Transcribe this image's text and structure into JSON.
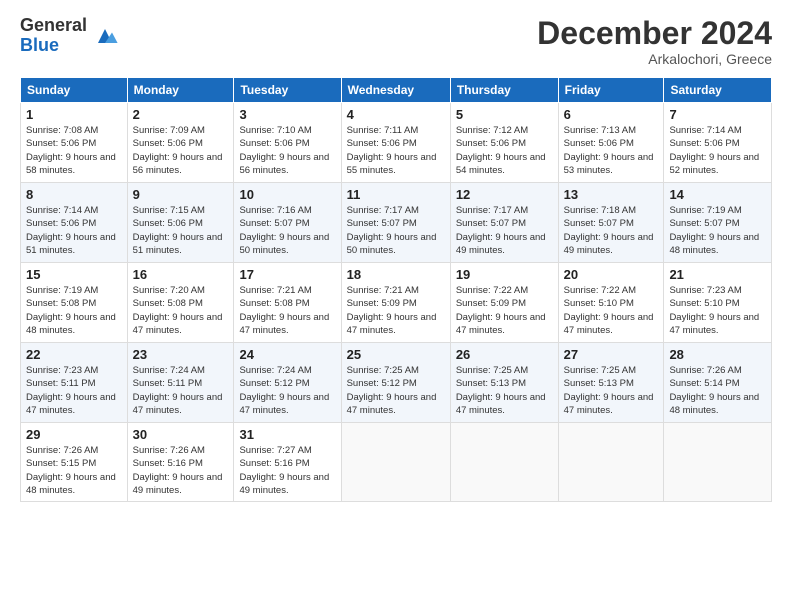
{
  "logo": {
    "general": "General",
    "blue": "Blue"
  },
  "header": {
    "month": "December 2024",
    "location": "Arkalochori, Greece"
  },
  "weekdays": [
    "Sunday",
    "Monday",
    "Tuesday",
    "Wednesday",
    "Thursday",
    "Friday",
    "Saturday"
  ],
  "weeks": [
    [
      {
        "day": "1",
        "sunrise": "7:08 AM",
        "sunset": "5:06 PM",
        "daylight": "9 hours and 58 minutes."
      },
      {
        "day": "2",
        "sunrise": "7:09 AM",
        "sunset": "5:06 PM",
        "daylight": "9 hours and 56 minutes."
      },
      {
        "day": "3",
        "sunrise": "7:10 AM",
        "sunset": "5:06 PM",
        "daylight": "9 hours and 56 minutes."
      },
      {
        "day": "4",
        "sunrise": "7:11 AM",
        "sunset": "5:06 PM",
        "daylight": "9 hours and 55 minutes."
      },
      {
        "day": "5",
        "sunrise": "7:12 AM",
        "sunset": "5:06 PM",
        "daylight": "9 hours and 54 minutes."
      },
      {
        "day": "6",
        "sunrise": "7:13 AM",
        "sunset": "5:06 PM",
        "daylight": "9 hours and 53 minutes."
      },
      {
        "day": "7",
        "sunrise": "7:14 AM",
        "sunset": "5:06 PM",
        "daylight": "9 hours and 52 minutes."
      }
    ],
    [
      {
        "day": "8",
        "sunrise": "7:14 AM",
        "sunset": "5:06 PM",
        "daylight": "9 hours and 51 minutes."
      },
      {
        "day": "9",
        "sunrise": "7:15 AM",
        "sunset": "5:06 PM",
        "daylight": "9 hours and 51 minutes."
      },
      {
        "day": "10",
        "sunrise": "7:16 AM",
        "sunset": "5:07 PM",
        "daylight": "9 hours and 50 minutes."
      },
      {
        "day": "11",
        "sunrise": "7:17 AM",
        "sunset": "5:07 PM",
        "daylight": "9 hours and 50 minutes."
      },
      {
        "day": "12",
        "sunrise": "7:17 AM",
        "sunset": "5:07 PM",
        "daylight": "9 hours and 49 minutes."
      },
      {
        "day": "13",
        "sunrise": "7:18 AM",
        "sunset": "5:07 PM",
        "daylight": "9 hours and 49 minutes."
      },
      {
        "day": "14",
        "sunrise": "7:19 AM",
        "sunset": "5:07 PM",
        "daylight": "9 hours and 48 minutes."
      }
    ],
    [
      {
        "day": "15",
        "sunrise": "7:19 AM",
        "sunset": "5:08 PM",
        "daylight": "9 hours and 48 minutes."
      },
      {
        "day": "16",
        "sunrise": "7:20 AM",
        "sunset": "5:08 PM",
        "daylight": "9 hours and 47 minutes."
      },
      {
        "day": "17",
        "sunrise": "7:21 AM",
        "sunset": "5:08 PM",
        "daylight": "9 hours and 47 minutes."
      },
      {
        "day": "18",
        "sunrise": "7:21 AM",
        "sunset": "5:09 PM",
        "daylight": "9 hours and 47 minutes."
      },
      {
        "day": "19",
        "sunrise": "7:22 AM",
        "sunset": "5:09 PM",
        "daylight": "9 hours and 47 minutes."
      },
      {
        "day": "20",
        "sunrise": "7:22 AM",
        "sunset": "5:10 PM",
        "daylight": "9 hours and 47 minutes."
      },
      {
        "day": "21",
        "sunrise": "7:23 AM",
        "sunset": "5:10 PM",
        "daylight": "9 hours and 47 minutes."
      }
    ],
    [
      {
        "day": "22",
        "sunrise": "7:23 AM",
        "sunset": "5:11 PM",
        "daylight": "9 hours and 47 minutes."
      },
      {
        "day": "23",
        "sunrise": "7:24 AM",
        "sunset": "5:11 PM",
        "daylight": "9 hours and 47 minutes."
      },
      {
        "day": "24",
        "sunrise": "7:24 AM",
        "sunset": "5:12 PM",
        "daylight": "9 hours and 47 minutes."
      },
      {
        "day": "25",
        "sunrise": "7:25 AM",
        "sunset": "5:12 PM",
        "daylight": "9 hours and 47 minutes."
      },
      {
        "day": "26",
        "sunrise": "7:25 AM",
        "sunset": "5:13 PM",
        "daylight": "9 hours and 47 minutes."
      },
      {
        "day": "27",
        "sunrise": "7:25 AM",
        "sunset": "5:13 PM",
        "daylight": "9 hours and 47 minutes."
      },
      {
        "day": "28",
        "sunrise": "7:26 AM",
        "sunset": "5:14 PM",
        "daylight": "9 hours and 48 minutes."
      }
    ],
    [
      {
        "day": "29",
        "sunrise": "7:26 AM",
        "sunset": "5:15 PM",
        "daylight": "9 hours and 48 minutes."
      },
      {
        "day": "30",
        "sunrise": "7:26 AM",
        "sunset": "5:16 PM",
        "daylight": "9 hours and 49 minutes."
      },
      {
        "day": "31",
        "sunrise": "7:27 AM",
        "sunset": "5:16 PM",
        "daylight": "9 hours and 49 minutes."
      },
      null,
      null,
      null,
      null
    ]
  ]
}
